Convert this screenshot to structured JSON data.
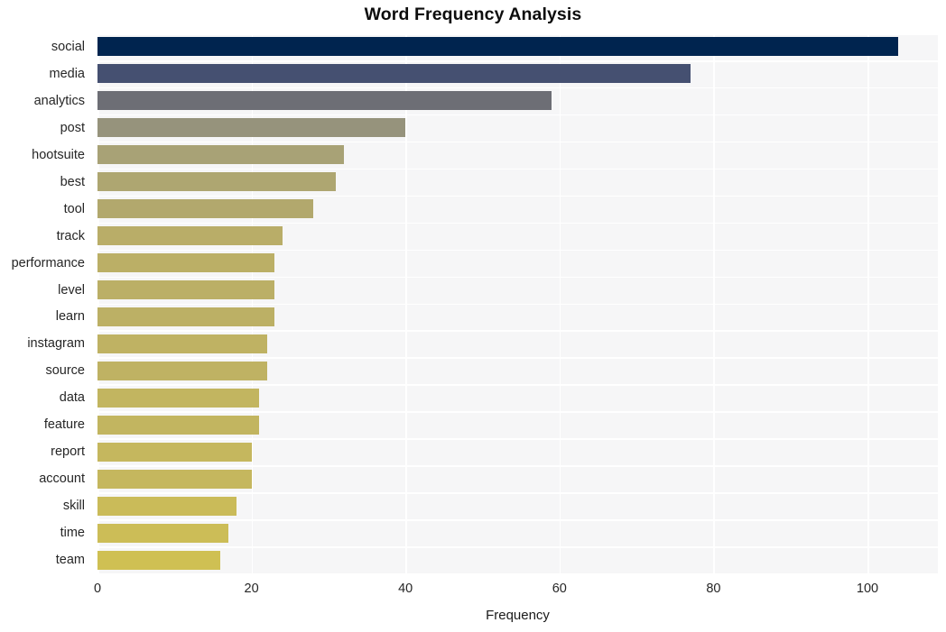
{
  "chart_data": {
    "type": "bar",
    "orientation": "horizontal",
    "title": "Word Frequency Analysis",
    "xlabel": "Frequency",
    "ylabel": "",
    "xlim": [
      0,
      109
    ],
    "xticks": [
      0,
      20,
      40,
      60,
      80,
      100
    ],
    "xticklabels": [
      "0",
      "20",
      "40",
      "60",
      "80",
      "100"
    ],
    "grid": true,
    "legend": false,
    "categories": [
      "social",
      "media",
      "analytics",
      "post",
      "hootsuite",
      "best",
      "tool",
      "track",
      "performance",
      "level",
      "learn",
      "instagram",
      "source",
      "data",
      "feature",
      "report",
      "account",
      "skill",
      "time",
      "team"
    ],
    "values": [
      104,
      77,
      59,
      40,
      32,
      31,
      28,
      24,
      23,
      23,
      23,
      22,
      22,
      21,
      21,
      20,
      20,
      18,
      17,
      16
    ],
    "bar_colors": [
      "#00244f",
      "#455071",
      "#6d6e75",
      "#96937c",
      "#a8a276",
      "#aea671",
      "#b2a86d",
      "#b9ad68",
      "#bbaf66",
      "#bbaf66",
      "#bcb065",
      "#bfb263",
      "#bfb263",
      "#c2b560",
      "#c2b560",
      "#c5b75e",
      "#c5b75e",
      "#cabb59",
      "#ccbd57",
      "#cfc053"
    ],
    "plot_background": "#f6f6f7",
    "grid_color": "#ffffff",
    "text_color": "#262626"
  }
}
